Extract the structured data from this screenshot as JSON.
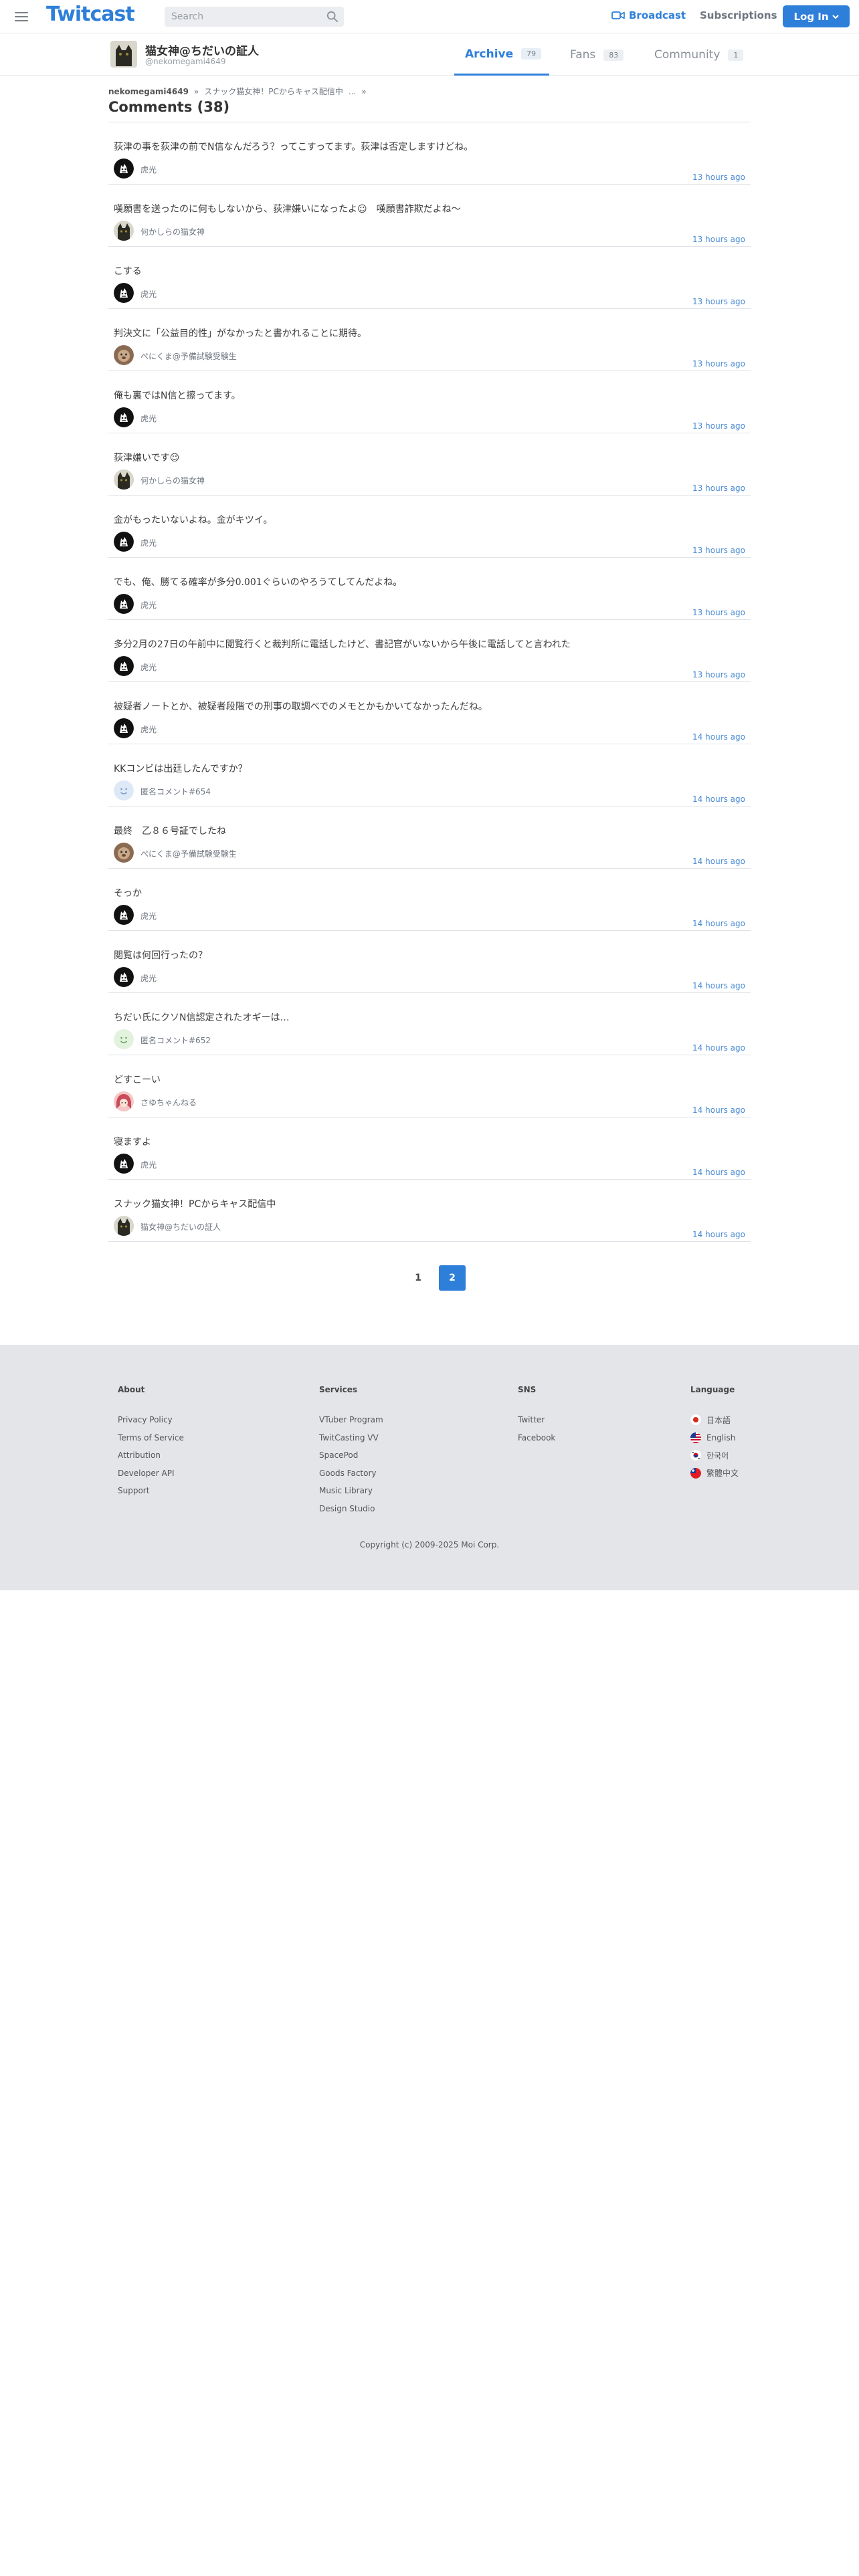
{
  "header": {
    "logo": "Twitcast",
    "search_placeholder": "Search",
    "broadcast_label": "Broadcast",
    "subscriptions_label": "Subscriptions",
    "login_label": "Log In",
    "accent_color": "#2e7fd9"
  },
  "profile": {
    "name": "猫女神@ちだいの証人",
    "handle": "@nekomegami4649"
  },
  "tabs": [
    {
      "label": "Archive",
      "count": "79",
      "active": true
    },
    {
      "label": "Fans",
      "count": "83",
      "active": false
    },
    {
      "label": "Community",
      "count": "1",
      "active": false
    }
  ],
  "breadcrumb": {
    "user": "nekomegami4649",
    "sep1": "»",
    "movie": "スナック猫女神！PCからキャス配信中",
    "ellipsis": "...",
    "sep2": "»"
  },
  "page_title": "Comments (38)",
  "comments": [
    {
      "text": "荻津の事を荻津の前でN信なんだろう？ってこすってます。荻津は否定しますけどね。",
      "user": "虎光",
      "avatar": "tiger-icon",
      "time": "13 hours ago"
    },
    {
      "text": "嘆願書を送ったのに何もしないから、荻津嫌いになったよ☺　嘆願書詐欺だよね〜",
      "user": "何かしらの猫女神",
      "avatar": "cat-icon",
      "time": "13 hours ago"
    },
    {
      "text": "こする",
      "user": "虎光",
      "avatar": "tiger-icon",
      "time": "13 hours ago"
    },
    {
      "text": "判決文に「公益目的性」がなかったと書かれることに期待。",
      "user": "ぺにくま@予備試験受験生",
      "avatar": "bear-icon",
      "time": "13 hours ago"
    },
    {
      "text": "俺も裏ではN信と擦ってます。",
      "user": "虎光",
      "avatar": "tiger-icon",
      "time": "13 hours ago"
    },
    {
      "text": "荻津嫌いです☺",
      "user": "何かしらの猫女神",
      "avatar": "cat-icon",
      "time": "13 hours ago"
    },
    {
      "text": "金がもったいないよね。金がキツイ。",
      "user": "虎光",
      "avatar": "tiger-icon",
      "time": "13 hours ago"
    },
    {
      "text": "でも、俺、勝てる確率が多分0.001ぐらいのやろうてしてんだよね。",
      "user": "虎光",
      "avatar": "tiger-icon",
      "time": "13 hours ago"
    },
    {
      "text": "多分2月の27日の午前中に閲覧行くと裁判所に電話したけど、書記官がいないから午後に電話してと言われた",
      "user": "虎光",
      "avatar": "tiger-icon",
      "time": "13 hours ago"
    },
    {
      "text": "被疑者ノートとか、被疑者段階での刑事の取調べでのメモとかもかいてなかったんだね。",
      "user": "虎光",
      "avatar": "tiger-icon",
      "time": "14 hours ago"
    },
    {
      "text": "KKコンビは出廷したんですか？",
      "user": "匿名コメント#654",
      "avatar": "anon-icon",
      "time": "14 hours ago"
    },
    {
      "text": "最終　乙８６号証でしたね",
      "user": "ぺにくま@予備試験受験生",
      "avatar": "bear-icon",
      "time": "14 hours ago"
    },
    {
      "text": "そっか",
      "user": "虎光",
      "avatar": "tiger-icon",
      "time": "14 hours ago"
    },
    {
      "text": "閲覧は何回行ったの？",
      "user": "虎光",
      "avatar": "tiger-icon",
      "time": "14 hours ago"
    },
    {
      "text": "ちだい氏にクソN信認定されたオギーは…",
      "user": "匿名コメント#652",
      "avatar": "anon-green-icon",
      "time": "14 hours ago"
    },
    {
      "text": "どすこーい",
      "user": "さゆちゃんねる",
      "avatar": "girl-icon",
      "time": "14 hours ago"
    },
    {
      "text": "寝ますよ",
      "user": "虎光",
      "avatar": "tiger-icon",
      "time": "14 hours ago"
    },
    {
      "text": "スナック猫女神！PCからキャス配信中",
      "user": "猫女神@ちだいの証人",
      "avatar": "cat-icon",
      "time": "14 hours ago"
    }
  ],
  "pagination": {
    "pages": [
      "1",
      "2"
    ],
    "current": "2"
  },
  "footer": {
    "about": {
      "title": "About",
      "links": [
        "Privacy Policy",
        "Terms of Service",
        "Attribution",
        "Developer API",
        "Support"
      ]
    },
    "services": {
      "title": "Services",
      "links": [
        "VTuber Program",
        "TwitCasting VV",
        "SpacePod",
        "Goods Factory",
        "Music Library",
        "Design Studio"
      ]
    },
    "sns": {
      "title": "SNS",
      "links": [
        "Twitter",
        "Facebook"
      ]
    },
    "language": {
      "title": "Language",
      "links": [
        {
          "label": "日本語",
          "flag": "jp-flag-icon"
        },
        {
          "label": "English",
          "flag": "us-flag-icon"
        },
        {
          "label": "한국어",
          "flag": "kr-flag-icon"
        },
        {
          "label": "繁體中文",
          "flag": "tw-flag-icon"
        }
      ]
    },
    "copyright": "Copyright (c) 2009-2025 Moi Corp."
  }
}
